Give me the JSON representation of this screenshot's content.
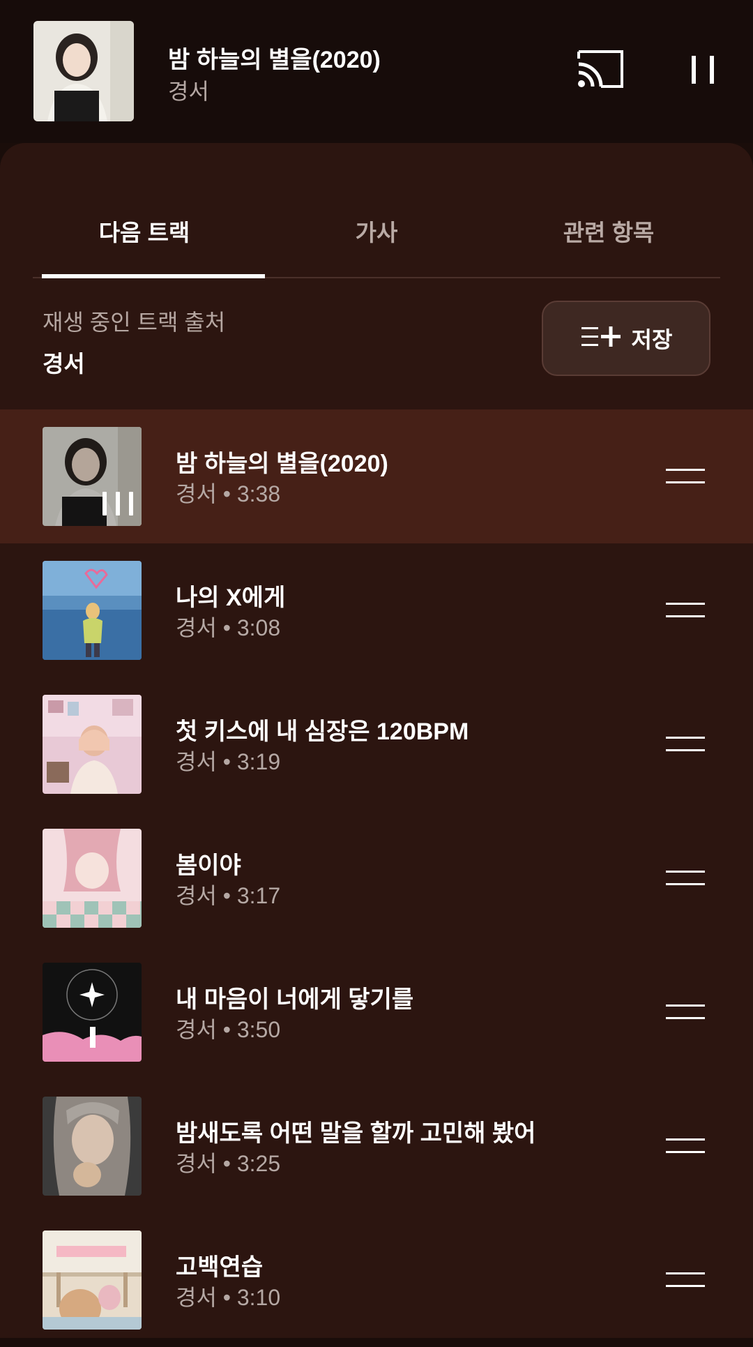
{
  "now_playing": {
    "title": "밤 하늘의 별을(2020)",
    "artist": "경서",
    "cast_icon": "cast-icon",
    "pause_icon": "pause-icon",
    "artwork_colors": [
      "#e9e6df",
      "#2a2320",
      "#d9d6cc"
    ]
  },
  "tabs": [
    {
      "label": "다음 트랙",
      "active": true
    },
    {
      "label": "가사",
      "active": false
    },
    {
      "label": "관련 항목",
      "active": false
    }
  ],
  "queue_source": {
    "label": "재생 중인 트랙 출처",
    "name": "경서",
    "save_label": "저장",
    "save_icon": "playlist-add-icon"
  },
  "tracks": [
    {
      "title": "밤 하늘의 별을(2020)",
      "subtitle": "경서 • 3:38",
      "playing": true,
      "art": [
        "#e6e4dc",
        "#2b2421",
        "#cfcbc0"
      ]
    },
    {
      "title": "나의 X에게",
      "subtitle": "경서 • 3:08",
      "playing": false,
      "art": [
        "#5a8fbf",
        "#3a6fa5",
        "#c9d46a"
      ]
    },
    {
      "title": "첫 키스에 내 심장은 120BPM",
      "subtitle": "경서 • 3:19",
      "playing": false,
      "art": [
        "#e8c9d6",
        "#c99aa8",
        "#f5e8e0"
      ]
    },
    {
      "title": "봄이야",
      "subtitle": "경서 • 3:17",
      "playing": false,
      "art": [
        "#f2d0d3",
        "#e3a9b3",
        "#9fc3b7"
      ]
    },
    {
      "title": "내 마음이 너에게 닿기를",
      "subtitle": "경서 • 3:50",
      "playing": false,
      "art": [
        "#111111",
        "#e98fb7",
        "#ffffff"
      ]
    },
    {
      "title": "밤새도록 어떤 말을 할까 고민해 봤어",
      "subtitle": "경서 • 3:25",
      "playing": false,
      "art": [
        "#3b3b3b",
        "#a9a39d",
        "#d4b79a"
      ]
    },
    {
      "title": "고백연습",
      "subtitle": "경서 • 3:10",
      "playing": false,
      "art": [
        "#e8dccb",
        "#d6a980",
        "#b4c9d4"
      ]
    }
  ],
  "colors": {
    "background": "#2c1510",
    "current_row": "#462017",
    "header": "#170c0a"
  }
}
